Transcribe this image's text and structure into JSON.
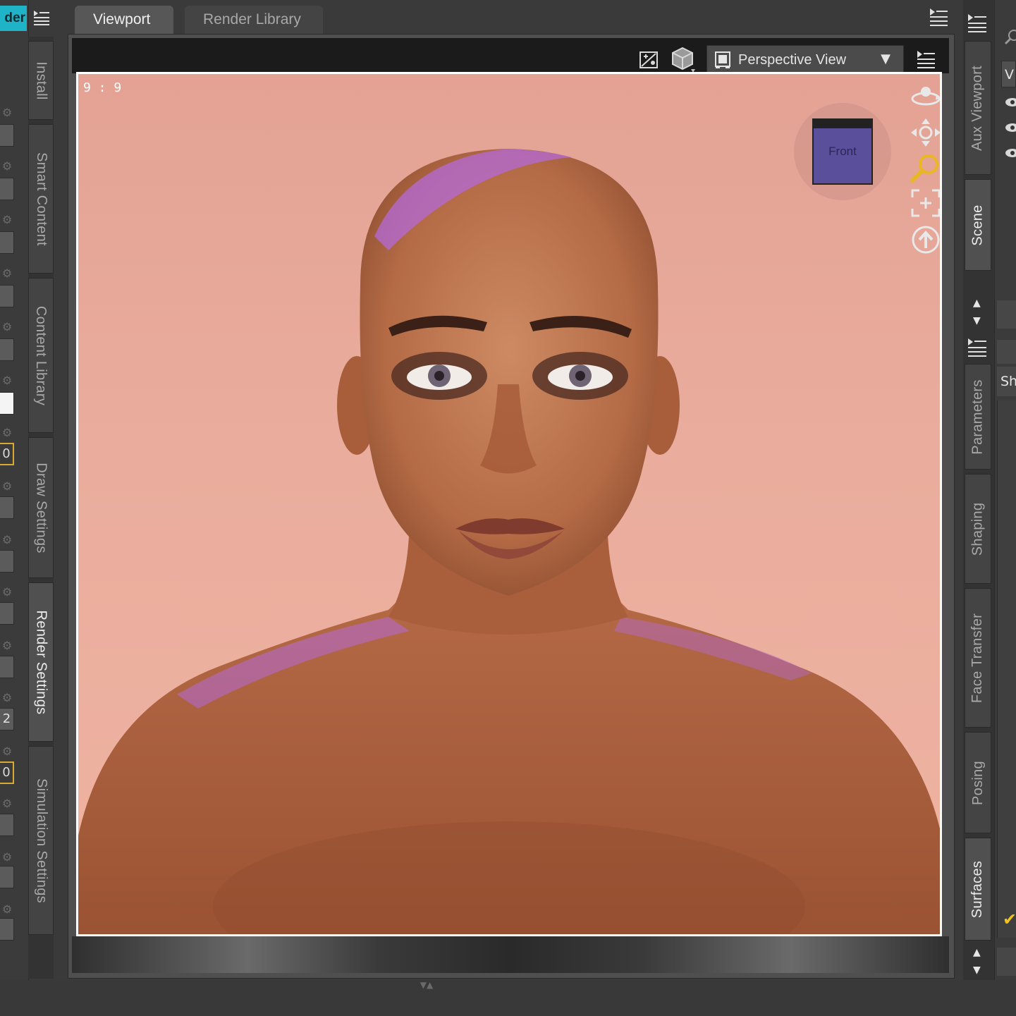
{
  "left_pane": {
    "top_tab_label": "der",
    "number_values": [
      "0",
      "2",
      "0"
    ]
  },
  "left_tabs": [
    {
      "label": "Install",
      "active": false
    },
    {
      "label": "Smart Content",
      "active": false
    },
    {
      "label": "Content Library",
      "active": false
    },
    {
      "label": "Draw Settings",
      "active": false
    },
    {
      "label": "Render Settings",
      "active": true
    },
    {
      "label": "Simulation Settings",
      "active": false
    }
  ],
  "center_tabs": [
    {
      "label": "Viewport",
      "active": true
    },
    {
      "label": "Render Library",
      "active": false
    }
  ],
  "viewport": {
    "view_select": "Perspective View",
    "aspect_label": "9 : 9",
    "nav_cube_label": "Front",
    "nav_tools": [
      "orbit-icon",
      "pan-icon",
      "zoom-icon",
      "frame-icon",
      "reset-view-icon"
    ]
  },
  "right_tabs_top": [
    {
      "label": "Aux Viewport",
      "active": false
    },
    {
      "label": "Scene",
      "active": true
    }
  ],
  "right_tabs_bottom": [
    {
      "label": "Parameters",
      "active": false
    },
    {
      "label": "Shaping",
      "active": false
    },
    {
      "label": "Face Transfer",
      "active": false
    },
    {
      "label": "Posing",
      "active": false
    },
    {
      "label": "Surfaces",
      "active": true
    }
  ],
  "right_pane": {
    "input_v": "V",
    "input_sh": "Sh"
  },
  "colors": {
    "accent_tab": "#1fb3c7",
    "highlight_border": "#d9a930",
    "checkmark": "#f0c419",
    "background": "#e8a898"
  }
}
